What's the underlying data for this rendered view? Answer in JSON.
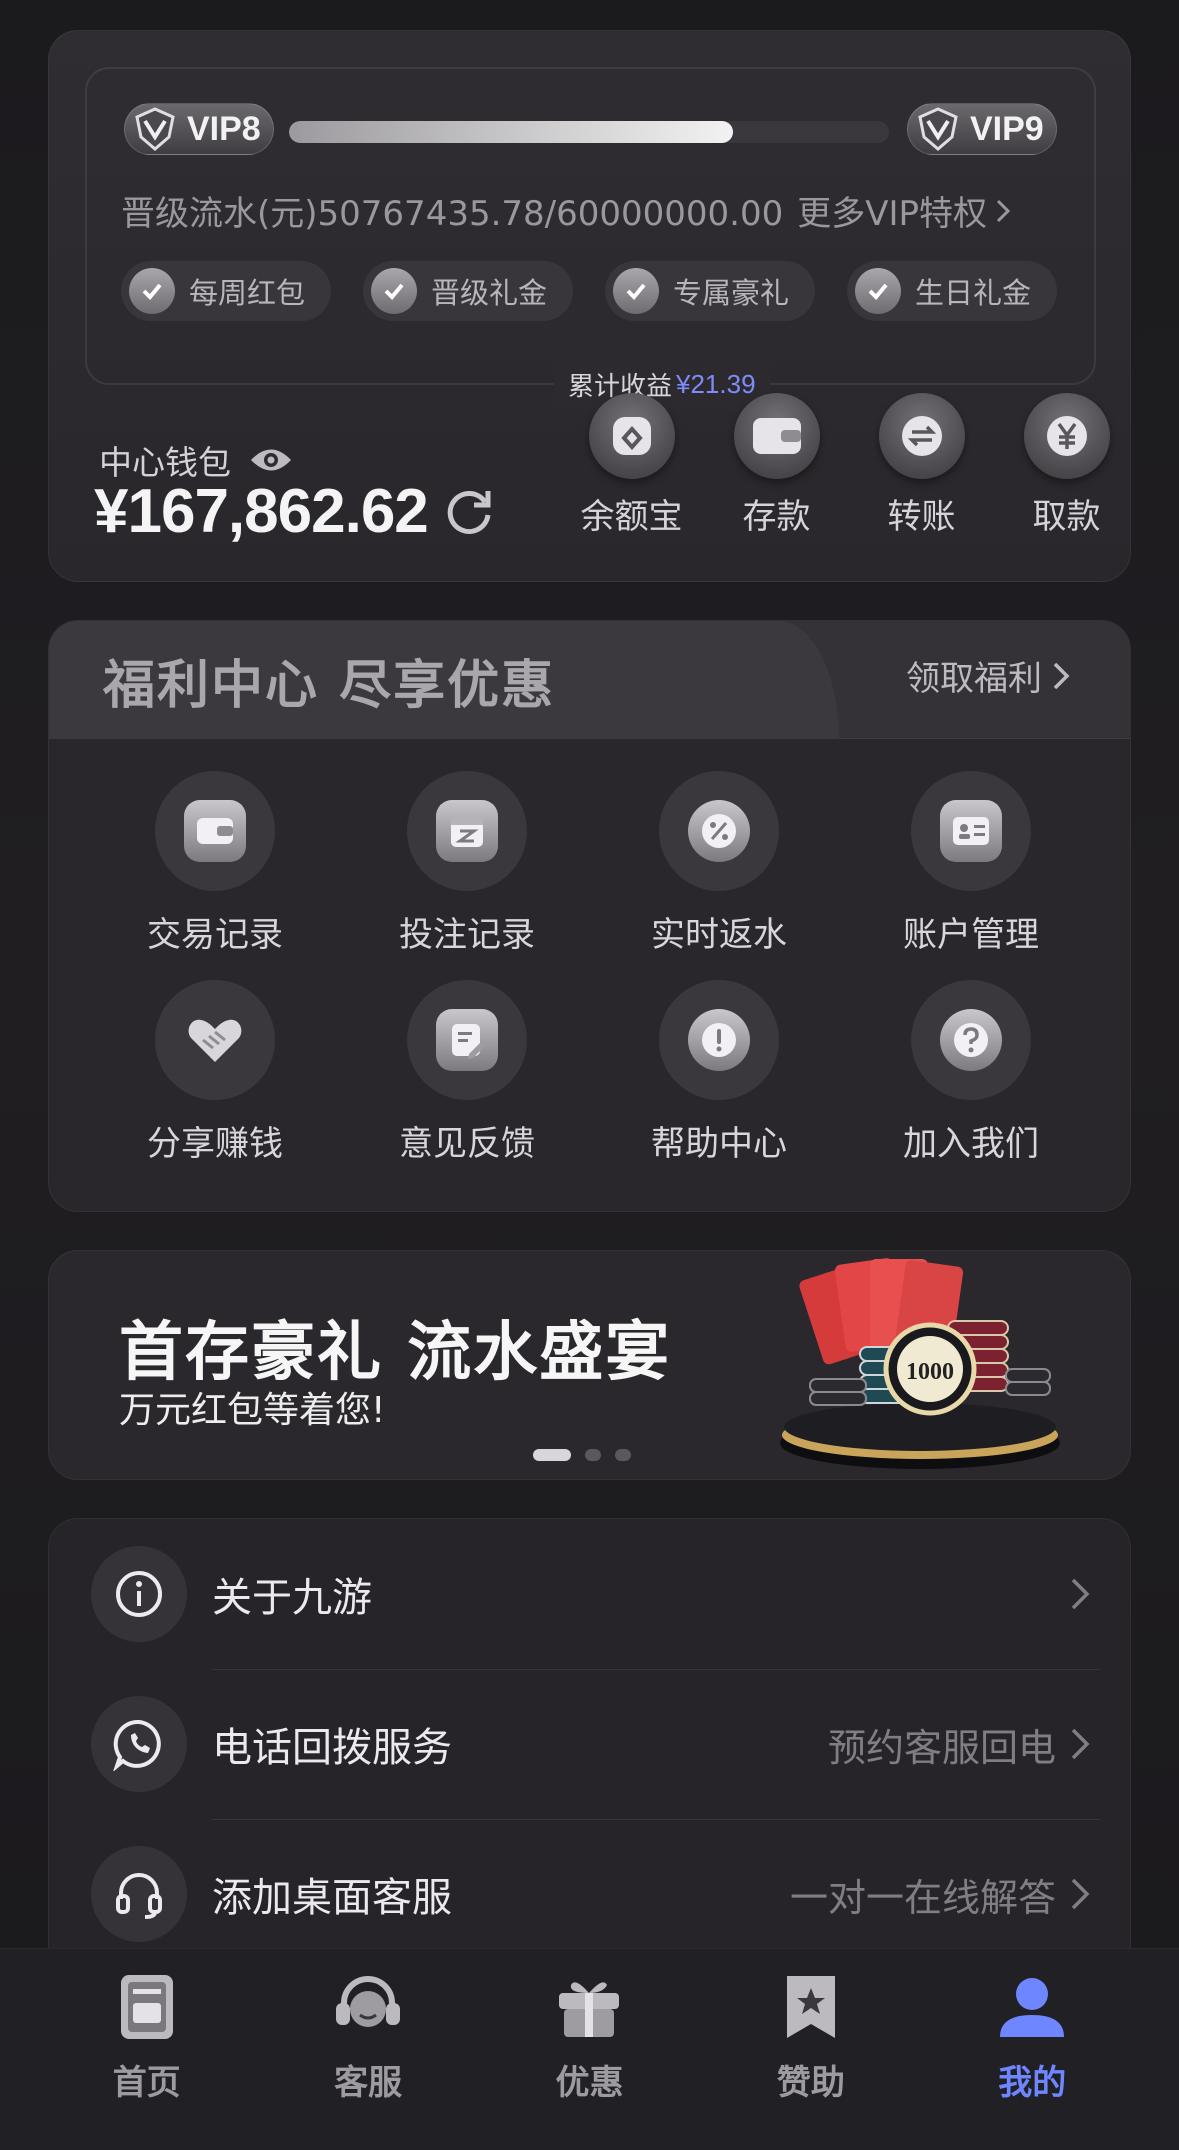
{
  "vip": {
    "current_level": "VIP8",
    "next_level": "VIP9",
    "progress_fraction": 0.74,
    "flow_text": "晋级流水(元)50767435.78/60000000.00",
    "more_privileges": "更多VIP特权",
    "privileges": [
      "每周红包",
      "晋级礼金",
      "专属豪礼",
      "生日礼金"
    ],
    "earnings_label": "累计收益",
    "earnings_value": "¥21.39"
  },
  "wallet": {
    "label": "中心钱包",
    "amount": "¥167,862.62",
    "actions": [
      {
        "label": "余额宝",
        "icon": "yuebao-icon"
      },
      {
        "label": "存款",
        "icon": "wallet-icon"
      },
      {
        "label": "转账",
        "icon": "transfer-icon"
      },
      {
        "label": "取款",
        "icon": "yen-icon"
      }
    ]
  },
  "welfare": {
    "title": "福利中心 尽享优惠",
    "claim": "领取福利",
    "items": [
      {
        "label": "交易记录",
        "icon": "wallet-icon"
      },
      {
        "label": "投注记录",
        "icon": "calendar-icon"
      },
      {
        "label": "实时返水",
        "icon": "percent-badge-icon"
      },
      {
        "label": "账户管理",
        "icon": "id-card-icon"
      },
      {
        "label": "分享赚钱",
        "icon": "handshake-icon"
      },
      {
        "label": "意见反馈",
        "icon": "edit-doc-icon"
      },
      {
        "label": "帮助中心",
        "icon": "exclamation-icon"
      },
      {
        "label": "加入我们",
        "icon": "question-icon"
      }
    ]
  },
  "banner": {
    "title": "首存豪礼 流水盛宴",
    "subtitle": "万元红包等着您!",
    "chip_value": "1000",
    "active_index": 0,
    "total": 3
  },
  "list": [
    {
      "label": "关于九游",
      "right": "",
      "icon": "info-icon"
    },
    {
      "label": "电话回拨服务",
      "right": "预约客服回电",
      "icon": "phone-chat-icon"
    },
    {
      "label": "添加桌面客服",
      "right": "一对一在线解答",
      "icon": "headset-icon"
    }
  ],
  "nav": {
    "items": [
      {
        "label": "首页",
        "icon": "home-icon"
      },
      {
        "label": "客服",
        "icon": "support-icon"
      },
      {
        "label": "优惠",
        "icon": "gift-icon"
      },
      {
        "label": "赞助",
        "icon": "bookmark-star-icon"
      },
      {
        "label": "我的",
        "icon": "profile-icon"
      }
    ],
    "active": "我的",
    "active_color": "#6e86ff"
  }
}
